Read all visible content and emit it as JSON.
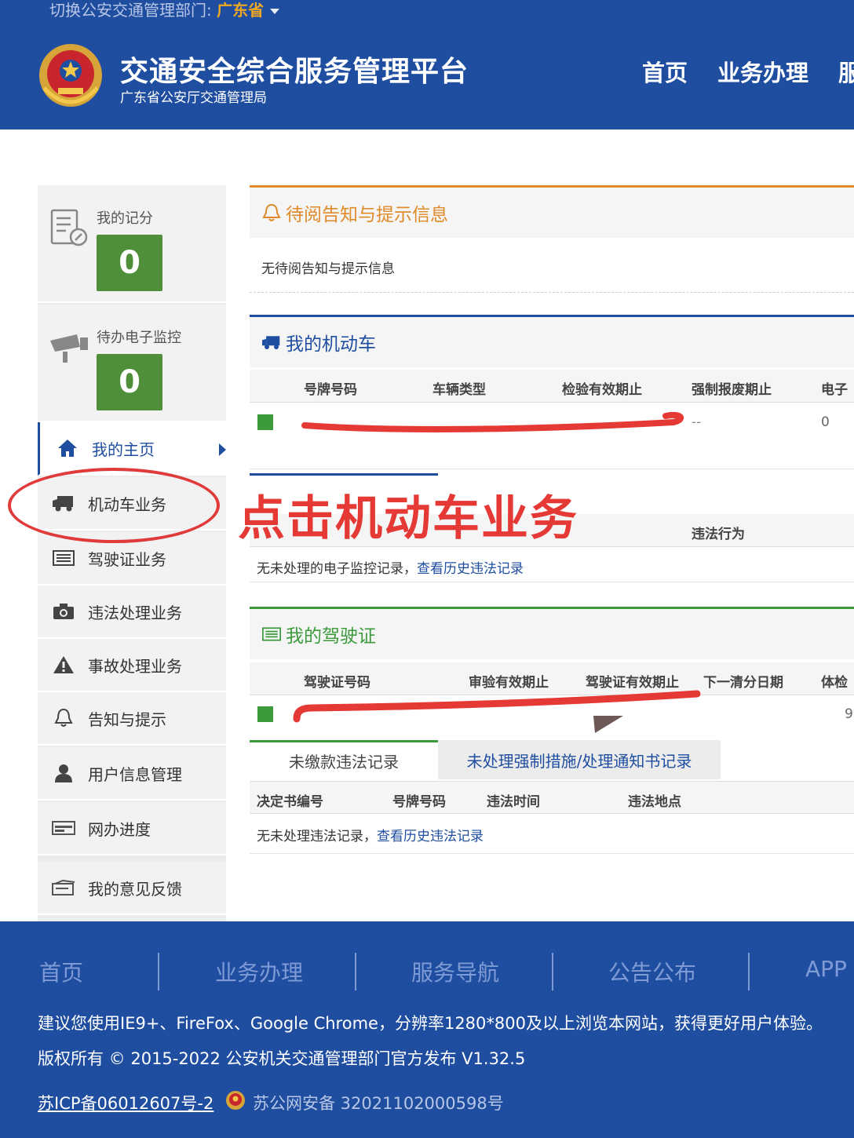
{
  "header": {
    "switch_label": "切换公安交通管理部门: ",
    "switch_value": "广东省",
    "title": "交通安全综合服务管理平台",
    "subtitle": "广东省公安厅交通管理局",
    "nav": [
      "首页",
      "业务办理",
      "服"
    ]
  },
  "sidebar": {
    "stats": [
      {
        "label": "我的记分",
        "value": "0",
        "icon": "score-doc-icon"
      },
      {
        "label": "待办电子监控",
        "value": "0",
        "icon": "camera-monitor-icon"
      }
    ],
    "menu": [
      {
        "label": "我的主页",
        "icon": "home-icon",
        "active": true
      },
      {
        "label": "机动车业务",
        "icon": "truck-icon"
      },
      {
        "label": "驾驶证业务",
        "icon": "license-card-icon"
      },
      {
        "label": "违法处理业务",
        "icon": "camera-icon"
      },
      {
        "label": "事故处理业务",
        "icon": "warning-icon"
      },
      {
        "label": "告知与提示",
        "icon": "bell-icon"
      },
      {
        "label": "用户信息管理",
        "icon": "user-icon"
      },
      {
        "label": "网办进度",
        "icon": "progress-icon"
      },
      {
        "label": "我的意见反馈",
        "icon": "feedback-icon"
      }
    ]
  },
  "annotation": {
    "text": "点击机动车业务"
  },
  "notice": {
    "title": "待阅告知与提示信息",
    "empty": "无待阅告知与提示信息"
  },
  "vehicles": {
    "title": "我的机动车",
    "columns": [
      "号牌号码",
      "车辆类型",
      "检验有效期止",
      "强制报废期止",
      "电子"
    ],
    "row": {
      "scrap": "--",
      "count": "0"
    }
  },
  "monitor": {
    "column": "违法行为",
    "empty": "无未处理的电子监控记录，",
    "link": "查看历史违法记录"
  },
  "license": {
    "title": "我的驾驶证",
    "columns": [
      "驾驶证号码",
      "审验有效期止",
      "驾驶证有效期止",
      "下一清分日期",
      "体检"
    ],
    "row_edge": "9"
  },
  "violations": {
    "tabs": [
      "未缴款违法记录",
      "未处理强制措施/处理通知书记录"
    ],
    "columns": [
      "决定书编号",
      "号牌号码",
      "违法时间",
      "违法地点"
    ],
    "empty": "无未处理违法记录，",
    "link": "查看历史违法记录"
  },
  "footer": {
    "nav": [
      "首页",
      "业务办理",
      "服务导航",
      "公告公布",
      "APP"
    ],
    "browser_tip": "建议您使用IE9+、FireFox、Google Chrome，分辨率1280*800及以上浏览本网站，获得更好用户体验。",
    "copyright": "版权所有 © 2015-2022 公安机关交通管理部门官方发布 V1.32.5",
    "icp": "苏ICP备06012607号-2",
    "psb": "苏公网安备 32021102000598号"
  },
  "colors": {
    "primary": "#1f4ea1",
    "accent_orange": "#e08a2a",
    "accent_green": "#3b9a3a",
    "annotation_red": "#e53935"
  }
}
